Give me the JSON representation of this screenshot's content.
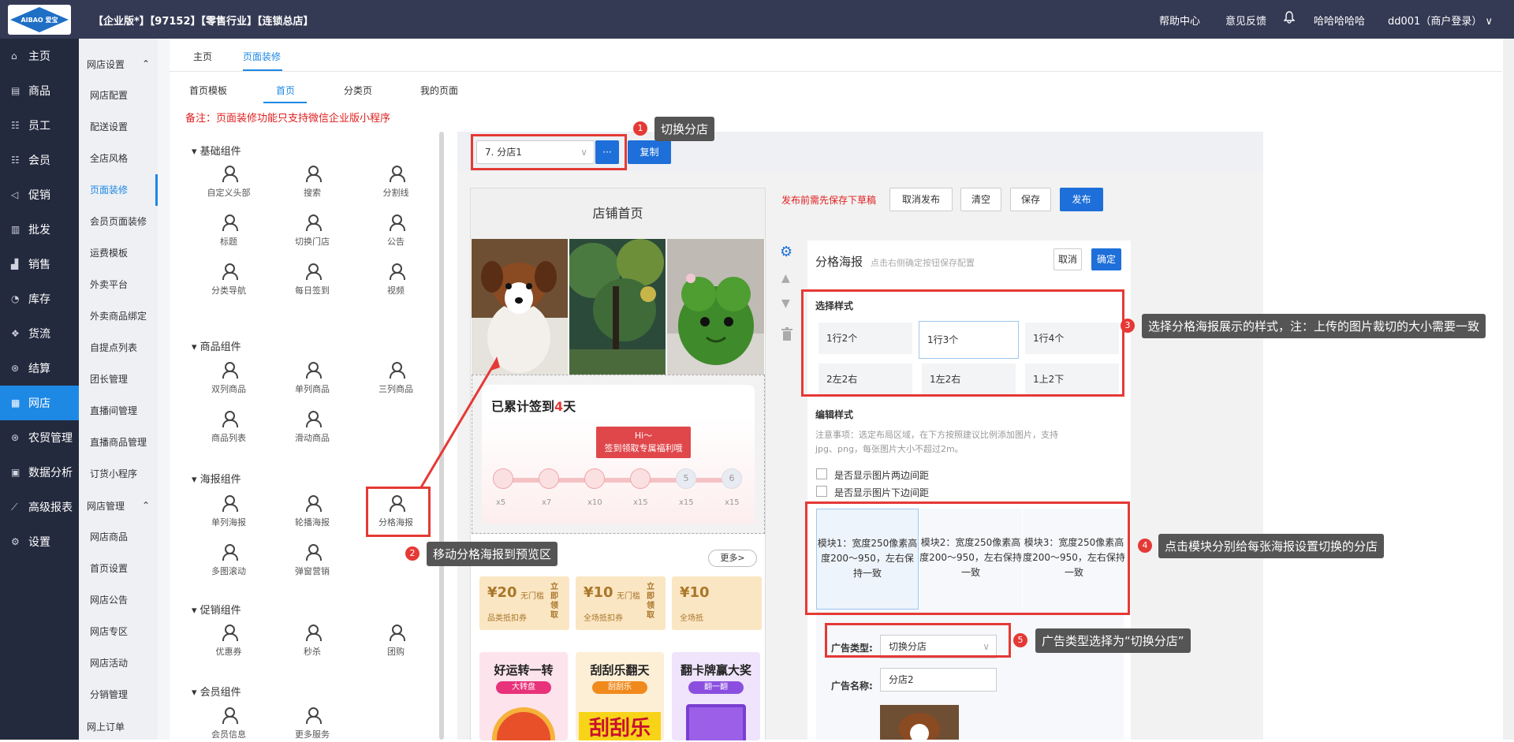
{
  "topbar": {
    "logo_text": "AIBAO 爱宝",
    "business": "【企业版*】【97152】【零售行业】【连锁总店】",
    "help": "帮助中心",
    "feedback": "意见反馈",
    "user_name": "哈哈哈哈哈",
    "account": "dd001（商户登录）",
    "chevron": "∨"
  },
  "mainnav": [
    {
      "label": "主页",
      "icon": "home-icon"
    },
    {
      "label": "商品",
      "icon": "box-icon"
    },
    {
      "label": "员工",
      "icon": "staff-icon"
    },
    {
      "label": "会员",
      "icon": "member-icon"
    },
    {
      "label": "促销",
      "icon": "megaphone-icon"
    },
    {
      "label": "批发",
      "icon": "list-icon"
    },
    {
      "label": "销售",
      "icon": "chart-icon"
    },
    {
      "label": "库存",
      "icon": "pie-icon"
    },
    {
      "label": "货流",
      "icon": "flow-icon"
    },
    {
      "label": "结算",
      "icon": "settle-icon"
    },
    {
      "label": "网店",
      "icon": "shop-icon"
    },
    {
      "label": "农贸管理",
      "icon": "farm-icon"
    },
    {
      "label": "数据分析",
      "icon": "data-icon"
    },
    {
      "label": "高级报表",
      "icon": "report-icon"
    },
    {
      "label": "设置",
      "icon": "gear-icon"
    }
  ],
  "subnav": {
    "group1": "网店设置",
    "group1_items": [
      "网店配置",
      "配送设置",
      "全店风格",
      "页面装修",
      "会员页面装修",
      "运费模板",
      "外卖平台",
      "外卖商品绑定",
      "自提点列表",
      "团长管理",
      "直播间管理",
      "直播商品管理",
      "订货小程序"
    ],
    "group2": "网店管理",
    "group2_items": [
      "网店商品",
      "首页设置",
      "网店公告",
      "网店专区",
      "网店活动",
      "分销管理"
    ],
    "group3": "网上订单",
    "expand": "⌃"
  },
  "tabs": {
    "home": "主页",
    "decor": "页面装修"
  },
  "subtabs": [
    "首页模板",
    "首页",
    "分类页",
    "我的页面"
  ],
  "note": "备注：页面装修功能只支持微信企业版小程序",
  "palette": {
    "basic": {
      "title": "基础组件",
      "items": [
        "自定义头部",
        "搜索",
        "分割线",
        "标题",
        "切换门店",
        "公告",
        "分类导航",
        "每日签到",
        "视频"
      ]
    },
    "goods": {
      "title": "商品组件",
      "items": [
        "双列商品",
        "单列商品",
        "三列商品",
        "商品列表",
        "滑动商品"
      ]
    },
    "poster": {
      "title": "海报组件",
      "items": [
        "单列海报",
        "轮播海报",
        "分格海报",
        "多图滚动",
        "弹窗营销"
      ]
    },
    "promo": {
      "title": "促销组件",
      "items": [
        "优惠券",
        "秒杀",
        "团购"
      ]
    },
    "member": {
      "title": "会员组件",
      "items": [
        "会员信息",
        "更多服务"
      ]
    }
  },
  "store_select": {
    "value": "7. 分店1",
    "more": "···",
    "copy": "复制"
  },
  "actions": {
    "hint": "发布前需先保存下草稿",
    "unpublish": "取消发布",
    "clear": "清空",
    "save": "保存",
    "publish": "发布"
  },
  "phone": {
    "title": "店铺首页",
    "signin_title_a": "已累计签到",
    "signin_num": "4",
    "signin_title_b": "天",
    "banner_line1": "Hi～",
    "banner_line2": "签到领取专属福利哦",
    "steps": [
      "",
      "",
      "",
      "",
      "5",
      "6"
    ],
    "rewards": [
      "x5",
      "x7",
      "x10",
      "x15",
      "x15",
      "x15"
    ],
    "more": "更多>",
    "coupons": [
      {
        "amount": "¥20",
        "cond": "无门槛",
        "desc": "品类抵扣券",
        "get": "立即领取"
      },
      {
        "amount": "¥10",
        "cond": "无门槛",
        "desc": "全场抵扣券",
        "get": "立即领取"
      },
      {
        "amount": "¥10",
        "cond": "",
        "desc": "全场抵",
        "get": ""
      }
    ],
    "games": [
      {
        "title": "好运转一转",
        "tag": "大转盘",
        "color": "#e8327a",
        "bg": "#fde3ec"
      },
      {
        "title": "刮刮乐翻天",
        "tag": "刮刮乐",
        "color": "#f08a1c",
        "bg": "#fdeed6"
      },
      {
        "title": "翻卡牌赢大奖",
        "tag": "翻一翻",
        "color": "#8b4fe0",
        "bg": "#efe4fb"
      }
    ],
    "scratch_text": "刮刮乐"
  },
  "editor": {
    "title": "分格海报",
    "subtitle": "点击右侧确定按钮保存配置",
    "cancel": "取消",
    "ok": "确定",
    "style_label": "选择样式",
    "styles": [
      "1行2个",
      "1行3个",
      "1行4个",
      "2左2右",
      "1左2右",
      "1上2下"
    ],
    "edit_label": "编辑样式",
    "edit_note": "注意事项：选定布局区域，在下方按照建议比例添加图片，支持jpg、png，每张图片大小不超过2m。",
    "opt1": "是否显示图片两边间距",
    "opt2": "是否显示图片下边间距",
    "blocks": [
      "模块1：宽度250像素高度200～950，左右保持一致",
      "模块2：宽度250像素高度200～950，左右保持一致",
      "模块3：宽度250像素高度200～950，左右保持一致"
    ],
    "ad_type_label": "广告类型:",
    "ad_type_value": "切换分店",
    "ad_name_label": "广告名称:",
    "ad_name_value": "分店2"
  },
  "callouts": [
    {
      "n": "1",
      "text": "切换分店"
    },
    {
      "n": "2",
      "text": "移动分格海报到预览区"
    },
    {
      "n": "3",
      "text": "选择分格海报展示的样式，注：上传的图片裁切的大小需要一致"
    },
    {
      "n": "4",
      "text": "点击模块分别给每张海报设置切换的分店"
    },
    {
      "n": "5",
      "text": "广告类型选择为“切换分店”"
    }
  ],
  "colors": {
    "accent": "#1e88e5",
    "nav_bg": "#242a3e",
    "top_bg": "#343a54",
    "annot_red": "#e53935"
  }
}
